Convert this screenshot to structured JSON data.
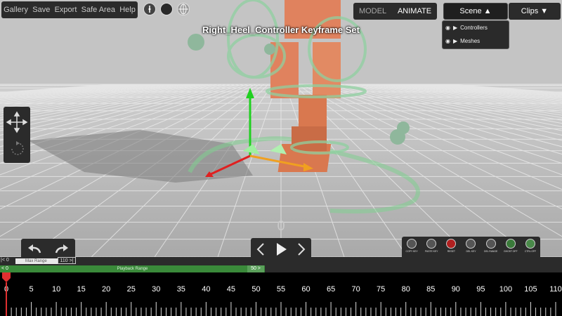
{
  "menu": {
    "items": [
      "Gallery",
      "Save",
      "Export",
      "Safe Area",
      "Help"
    ]
  },
  "view_icons": [
    "compass-icon",
    "sphere-icon",
    "wireframe-globe-icon"
  ],
  "mode": {
    "model_label": "MODEL",
    "animate_label": "ANIMATE",
    "active": "ANIMATE"
  },
  "tabs": {
    "scene_label": "Scene ▲",
    "clips_label": "Clips ▼"
  },
  "scene_dropdown": {
    "items": [
      "Controllers",
      "Meshes"
    ]
  },
  "viewport": {
    "title": "Right_Heel_Controller Keyframe Set"
  },
  "transport": {
    "frame": "0"
  },
  "key_buttons": [
    {
      "label": "COPY KEY",
      "icon": "copy-key-icon"
    },
    {
      "label": "PASTE KEY",
      "icon": "paste-key-icon"
    },
    {
      "label": "RESET",
      "icon": "reset-figure-icon"
    },
    {
      "label": "DEL KEY",
      "icon": "delete-key-icon"
    },
    {
      "label": "DEL RANGE",
      "icon": "delete-range-icon"
    },
    {
      "label": "GHOST OFF",
      "icon": "ghost-figure-icon"
    },
    {
      "label": "CTRL OFF",
      "icon": "control-figure-icon"
    }
  ],
  "range": {
    "max_left": "|< 0",
    "max_label": "Max Range",
    "max_right": "110 >|",
    "playback_left": "< 0",
    "playback_label": "Playback Range",
    "playback_right": "50 >"
  },
  "timeline": {
    "labels": [
      "0",
      "5",
      "10",
      "15",
      "20",
      "25",
      "30",
      "35",
      "40",
      "45",
      "50",
      "55",
      "60",
      "65",
      "70",
      "75",
      "80",
      "85",
      "90",
      "95",
      "100",
      "105",
      "110"
    ],
    "current": 0,
    "max": 110,
    "playhead_color": "#e03030"
  },
  "colors": {
    "accent_green": "#3a8a3a",
    "axis_x": "#e02020",
    "axis_y": "#20d020",
    "axis_z": "#f0a020"
  }
}
